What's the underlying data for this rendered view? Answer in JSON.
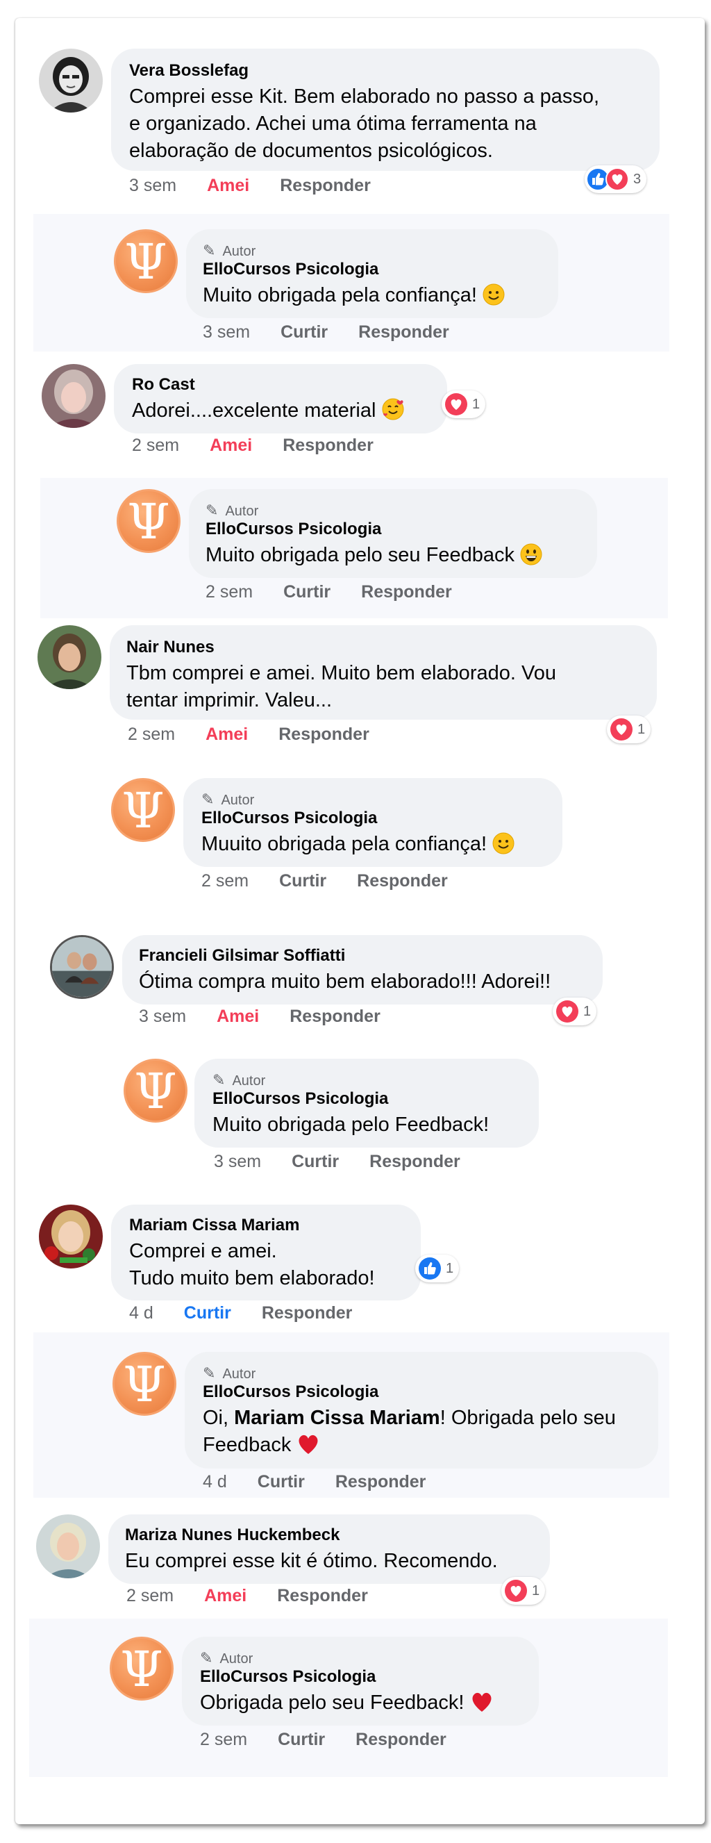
{
  "colors": {
    "love": "#f33e58",
    "like": "#1877f2",
    "muted": "#65676b",
    "bubble": "#f0f2f5"
  },
  "comments": [
    {
      "name": "Vera Bosslefag",
      "lines": [
        "Comprei esse Kit. Bem elaborado no passo a passo,",
        "e organizado. Achei uma ótima ferramenta na",
        "elaboração de documentos psicológicos."
      ],
      "time": "3 sem",
      "action": "Amei",
      "reply": "Responder",
      "reaction_count": "3"
    },
    {
      "author_label": "Autor",
      "name": "ElloCursos Psicologia",
      "lines": [
        "Muito obrigada pela confiança!"
      ],
      "time": "3 sem",
      "action": "Curtir",
      "reply": "Responder"
    },
    {
      "name": "Ro Cast",
      "lines": [
        "Adorei....excelente material"
      ],
      "time": "2 sem",
      "action": "Amei",
      "reply": "Responder",
      "reaction_count": "1"
    },
    {
      "author_label": "Autor",
      "name": "ElloCursos Psicologia",
      "lines": [
        "Muito obrigada pelo seu Feedback"
      ],
      "time": "2 sem",
      "action": "Curtir",
      "reply": "Responder"
    },
    {
      "name": "Nair Nunes",
      "lines": [
        "Tbm comprei  e amei. Muito bem elaborado. Vou",
        "tentar  imprimir. Valeu..."
      ],
      "time": "2 sem",
      "action": "Amei",
      "reply": "Responder",
      "reaction_count": "1"
    },
    {
      "author_label": "Autor",
      "name": "ElloCursos Psicologia",
      "lines": [
        "Muuito obrigada pela confiança!"
      ],
      "time": "2 sem",
      "action": "Curtir",
      "reply": "Responder"
    },
    {
      "name": "Francieli Gilsimar Soffiatti",
      "lines": [
        "Ótima compra muito bem elaborado!!! Adorei!!"
      ],
      "time": "3 sem",
      "action": "Amei",
      "reply": "Responder",
      "reaction_count": "1"
    },
    {
      "author_label": "Autor",
      "name": "ElloCursos Psicologia",
      "lines": [
        "Muito obrigada pelo Feedback!"
      ],
      "time": "3 sem",
      "action": "Curtir",
      "reply": "Responder"
    },
    {
      "name": "Mariam Cissa Mariam",
      "lines": [
        "Comprei e amei.",
        "Tudo muito bem elaborado!"
      ],
      "time": "4 d",
      "action": "Curtir",
      "reply": "Responder",
      "reaction_count": "1"
    },
    {
      "author_label": "Autor",
      "name": "ElloCursos Psicologia",
      "line1_pre": "Oi, ",
      "line1_mention": "Mariam Cissa Mariam",
      "line1_post": "! Obrigada pelo seu",
      "line2": "Feedback",
      "time": "4 d",
      "action": "Curtir",
      "reply": "Responder"
    },
    {
      "name": "Mariza Nunes Huckembeck",
      "lines": [
        "Eu comprei esse kit é  ótimo. Recomendo."
      ],
      "time": "2 sem",
      "action": "Amei",
      "reply": "Responder",
      "reaction_count": "1"
    },
    {
      "author_label": "Autor",
      "name": "ElloCursos Psicologia",
      "lines": [
        "Obrigada pelo seu Feedback!"
      ],
      "time": "2 sem",
      "action": "Curtir",
      "reply": "Responder"
    }
  ],
  "icons": {
    "psi_logo": "Ψ",
    "pen": "pencil-icon",
    "love": "heart-reaction-icon",
    "like": "thumbs-up-reaction-icon"
  }
}
